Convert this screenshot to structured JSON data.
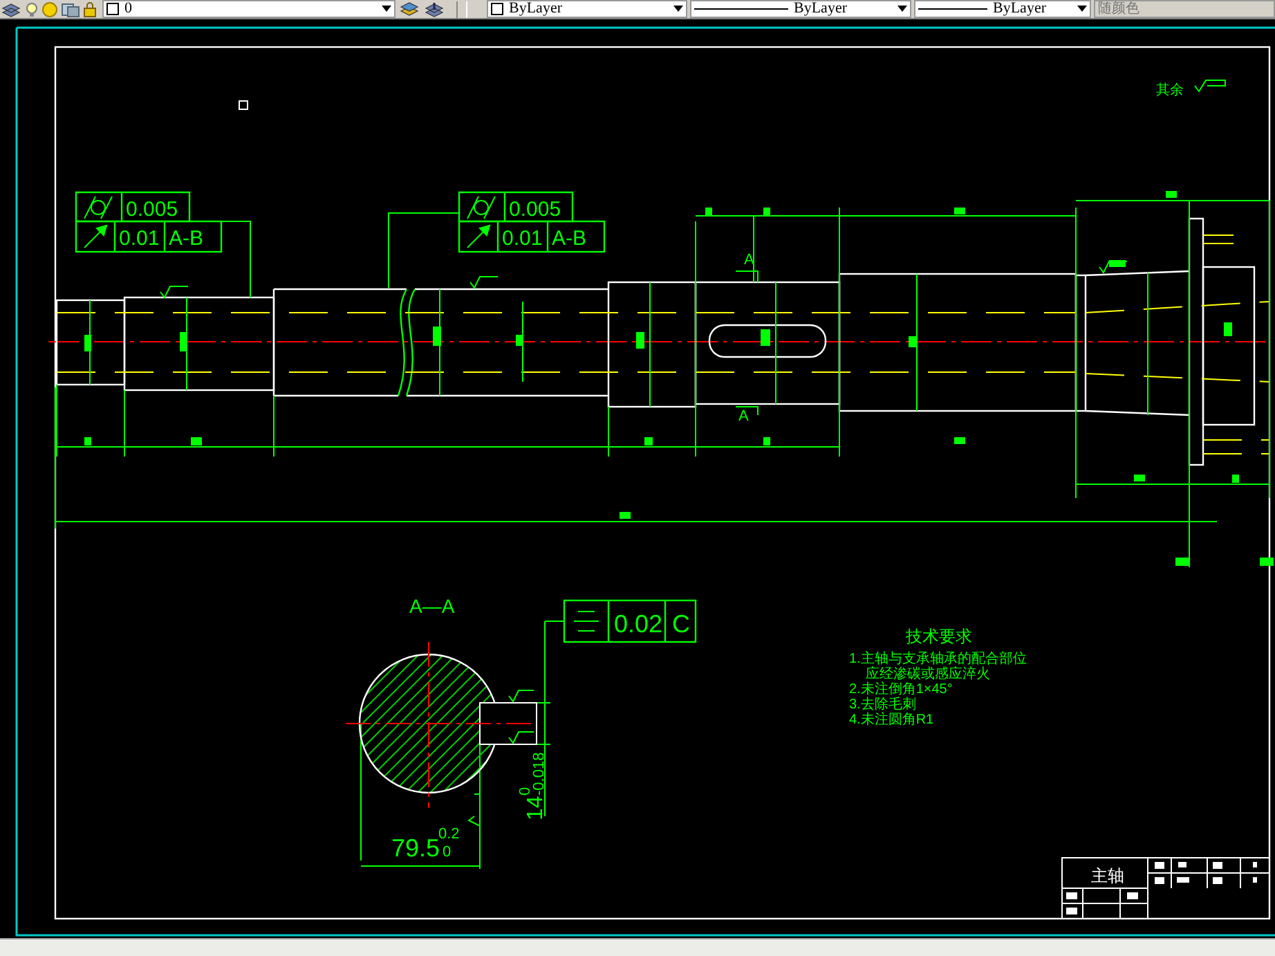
{
  "toolbar": {
    "layer": "0",
    "color_setting": "ByLayer",
    "linetype": "ByLayer",
    "lineweight": "ByLayer",
    "plot_style": "随颜色",
    "plot_style_disabled": true
  },
  "drawing": {
    "roughness_note": "其余",
    "tolerance_frames": [
      {
        "rows": [
          {
            "kind": "cylindricity",
            "tolerance": "0.005"
          },
          {
            "kind": "runout",
            "tolerance": "0.01",
            "datum": "A-B"
          }
        ]
      },
      {
        "rows": [
          {
            "kind": "cylindricity",
            "tolerance": "0.005"
          },
          {
            "kind": "runout",
            "tolerance": "0.01",
            "datum": "A-B"
          }
        ]
      }
    ],
    "section_marks": [
      "A",
      "A"
    ],
    "section": {
      "label": "A—A",
      "frame": {
        "kind": "symmetry",
        "tolerance": "0.02",
        "datum": "C"
      },
      "width_dim": {
        "value": "79.5",
        "upper": "0.2",
        "lower": "0"
      },
      "key_dim": {
        "value": "14",
        "upper": "0",
        "lower": "-0.018"
      }
    },
    "requirements": {
      "title": "技术要求",
      "lines": [
        "1.主轴与支承轴承的配合部位",
        "应经渗碳或感应淬火",
        "2.未注倒角1×45°",
        "3.去除毛刺",
        "4.未注圆角R1"
      ]
    },
    "title_block": {
      "part_name": "主轴"
    }
  }
}
